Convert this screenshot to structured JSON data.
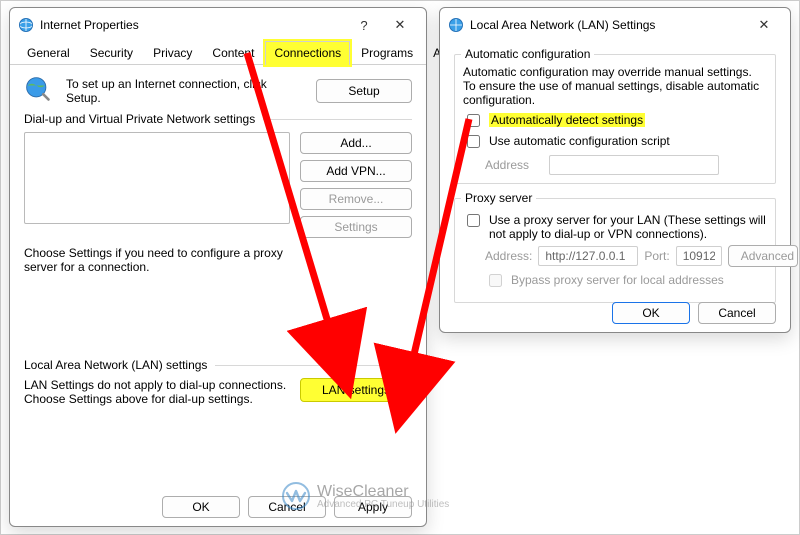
{
  "left": {
    "title": "Internet Properties",
    "tabs": [
      "General",
      "Security",
      "Privacy",
      "Content",
      "Connections",
      "Programs",
      "Advanced"
    ],
    "activeTab": "Connections",
    "setupText": "To set up an Internet connection, click Setup.",
    "setupBtn": "Setup",
    "dialupLegend": "Dial-up and Virtual Private Network settings",
    "addBtn": "Add...",
    "addVpnBtn": "Add VPN...",
    "removeBtn": "Remove...",
    "settingsBtn": "Settings",
    "dialupHelp": "Choose Settings if you need to configure a proxy server for a connection.",
    "lanLegend": "Local Area Network (LAN) settings",
    "lanHelp": "LAN Settings do not apply to dial-up connections. Choose Settings above for dial-up settings.",
    "lanBtn": "LAN settings",
    "ok": "OK",
    "cancel": "Cancel",
    "apply": "Apply"
  },
  "right": {
    "title": "Local Area Network (LAN) Settings",
    "autoLegend": "Automatic configuration",
    "autoText": "Automatic configuration may override manual settings.  To ensure the use of manual settings, disable automatic configuration.",
    "autoDetect": "Automatically detect settings",
    "autoScript": "Use automatic configuration script",
    "addressLabel": "Address",
    "addressValue": "",
    "proxyLegend": "Proxy server",
    "proxyUse": "Use a proxy server for your LAN (These settings will not apply to dial-up or VPN connections).",
    "proxyAddressLabel": "Address:",
    "proxyAddressValue": "http://127.0.0.1",
    "proxyPortLabel": "Port:",
    "proxyPortValue": "10912",
    "advancedBtn": "Advanced",
    "bypass": "Bypass proxy server for local addresses",
    "ok": "OK",
    "cancel": "Cancel"
  },
  "watermark": {
    "name": "WiseCleaner",
    "tag": "Advanced PC Tuneup Utilities"
  }
}
